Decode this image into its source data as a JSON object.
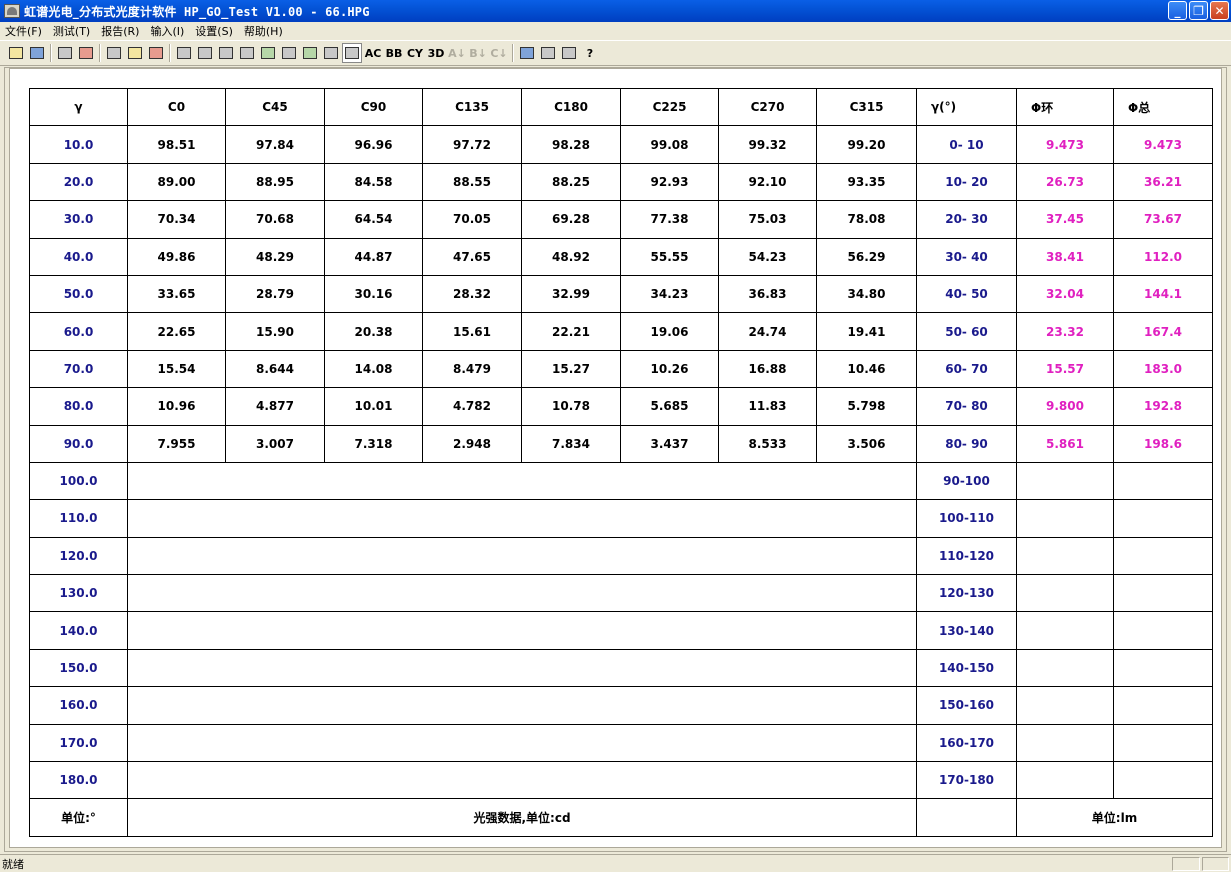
{
  "window": {
    "title_cn": "虹谱光电_分布式光度计软件",
    "title_en": " HP_GO_Test V1.00 - 66.HPG",
    "min_label": "_",
    "max_label": "❐",
    "close_label": "✕"
  },
  "menu": [
    "文件(F)",
    "测试(T)",
    "报告(R)",
    "输入(I)",
    "设置(S)",
    "帮助(H)"
  ],
  "toolbar": {
    "btn_ac": "AC",
    "btn_bb": "BB",
    "btn_cy": "CY",
    "btn_3d": "3D",
    "btn_a": "A↓",
    "btn_b": "B↓",
    "btn_c": "C↓",
    "btn_help": "?"
  },
  "table": {
    "headers": {
      "gamma": "γ",
      "c0": "C0",
      "c45": "C45",
      "c90": "C90",
      "c135": "C135",
      "c180": "C180",
      "c225": "C225",
      "c270": "C270",
      "c315": "C315",
      "range": "γ(°)",
      "phi_ring": "Φ环",
      "phi_total": "Φ总"
    },
    "rows": [
      {
        "g": "10.0",
        "c": [
          "98.51",
          "97.84",
          "96.96",
          "97.72",
          "98.28",
          "99.08",
          "99.32",
          "99.20"
        ],
        "r": "0- 10",
        "pr": "9.473",
        "pt": "9.473"
      },
      {
        "g": "20.0",
        "c": [
          "89.00",
          "88.95",
          "84.58",
          "88.55",
          "88.25",
          "92.93",
          "92.10",
          "93.35"
        ],
        "r": "10- 20",
        "pr": "26.73",
        "pt": "36.21"
      },
      {
        "g": "30.0",
        "c": [
          "70.34",
          "70.68",
          "64.54",
          "70.05",
          "69.28",
          "77.38",
          "75.03",
          "78.08"
        ],
        "r": "20- 30",
        "pr": "37.45",
        "pt": "73.67"
      },
      {
        "g": "40.0",
        "c": [
          "49.86",
          "48.29",
          "44.87",
          "47.65",
          "48.92",
          "55.55",
          "54.23",
          "56.29"
        ],
        "r": "30- 40",
        "pr": "38.41",
        "pt": "112.0"
      },
      {
        "g": "50.0",
        "c": [
          "33.65",
          "28.79",
          "30.16",
          "28.32",
          "32.99",
          "34.23",
          "36.83",
          "34.80"
        ],
        "r": "40- 50",
        "pr": "32.04",
        "pt": "144.1"
      },
      {
        "g": "60.0",
        "c": [
          "22.65",
          "15.90",
          "20.38",
          "15.61",
          "22.21",
          "19.06",
          "24.74",
          "19.41"
        ],
        "r": "50- 60",
        "pr": "23.32",
        "pt": "167.4"
      },
      {
        "g": "70.0",
        "c": [
          "15.54",
          "8.644",
          "14.08",
          "8.479",
          "15.27",
          "10.26",
          "16.88",
          "10.46"
        ],
        "r": "60- 70",
        "pr": "15.57",
        "pt": "183.0"
      },
      {
        "g": "80.0",
        "c": [
          "10.96",
          "4.877",
          "10.01",
          "4.782",
          "10.78",
          "5.685",
          "11.83",
          "5.798"
        ],
        "r": "70- 80",
        "pr": "9.800",
        "pt": "192.8"
      },
      {
        "g": "90.0",
        "c": [
          "7.955",
          "3.007",
          "7.318",
          "2.948",
          "7.834",
          "3.437",
          "8.533",
          "3.506"
        ],
        "r": "80- 90",
        "pr": "5.861",
        "pt": "198.6"
      },
      {
        "g": "100.0",
        "r": "90-100"
      },
      {
        "g": "110.0",
        "r": "100-110"
      },
      {
        "g": "120.0",
        "r": "110-120"
      },
      {
        "g": "130.0",
        "r": "120-130"
      },
      {
        "g": "140.0",
        "r": "130-140"
      },
      {
        "g": "150.0",
        "r": "140-150"
      },
      {
        "g": "160.0",
        "r": "150-160"
      },
      {
        "g": "170.0",
        "r": "160-170"
      },
      {
        "g": "180.0",
        "r": "170-180"
      }
    ],
    "footer": {
      "unit_angle": "单位:°",
      "intensity_label": "光强数据,单位:cd",
      "unit_flux": "单位:lm"
    }
  },
  "status": {
    "text": "就绪"
  }
}
